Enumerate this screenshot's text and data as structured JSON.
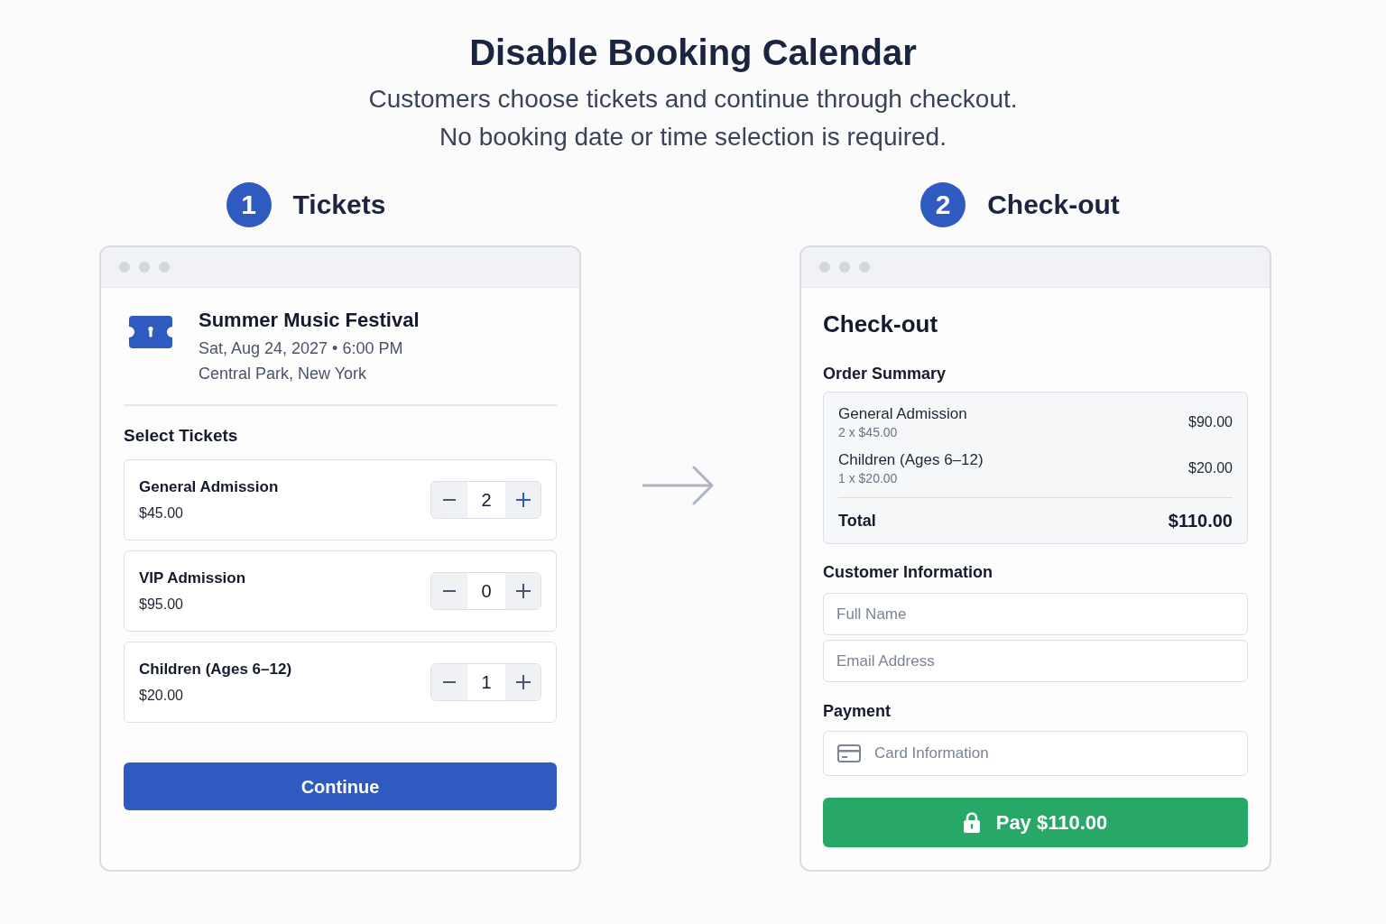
{
  "header": {
    "title": "Disable Booking Calendar",
    "subtitle_lines": [
      "Customers choose tickets and continue through checkout.",
      "No booking date or time selection is required."
    ]
  },
  "steps": [
    {
      "number": "1",
      "label": "Tickets"
    },
    {
      "number": "2",
      "label": "Check-out"
    }
  ],
  "tickets_window": {
    "event": {
      "name": "Summer Music Festival",
      "date_time": "Sat, Aug 24, 2027 • 6:00 PM",
      "location": "Central Park, New York"
    },
    "section_title": "Select Tickets",
    "tickets": [
      {
        "name": "General Admission",
        "price": "$45.00",
        "quantity": "2",
        "plus_active": true
      },
      {
        "name": "VIP Admission",
        "price": "$95.00",
        "quantity": "0",
        "plus_active": false
      },
      {
        "name": "Children (Ages 6–12)",
        "price": "$20.00",
        "quantity": "1",
        "plus_active": false
      }
    ],
    "continue_button": "Continue"
  },
  "checkout_window": {
    "title": "Check-out",
    "order_summary": {
      "title": "Order Summary",
      "items": [
        {
          "name": "General Admission",
          "detail": "2 x $45.00",
          "amount": "$90.00"
        },
        {
          "name": "Children (Ages 6–12)",
          "detail": "1 x $20.00",
          "amount": "$20.00"
        }
      ],
      "total_label": "Total",
      "total_amount": "$110.00"
    },
    "customer_information": {
      "title": "Customer Information",
      "fields": [
        {
          "placeholder": "Full Name"
        },
        {
          "placeholder": "Email Address"
        }
      ]
    },
    "payment": {
      "title": "Payment",
      "card_field": {
        "placeholder": "Card Information"
      }
    },
    "pay_button": "Pay $110.00"
  }
}
